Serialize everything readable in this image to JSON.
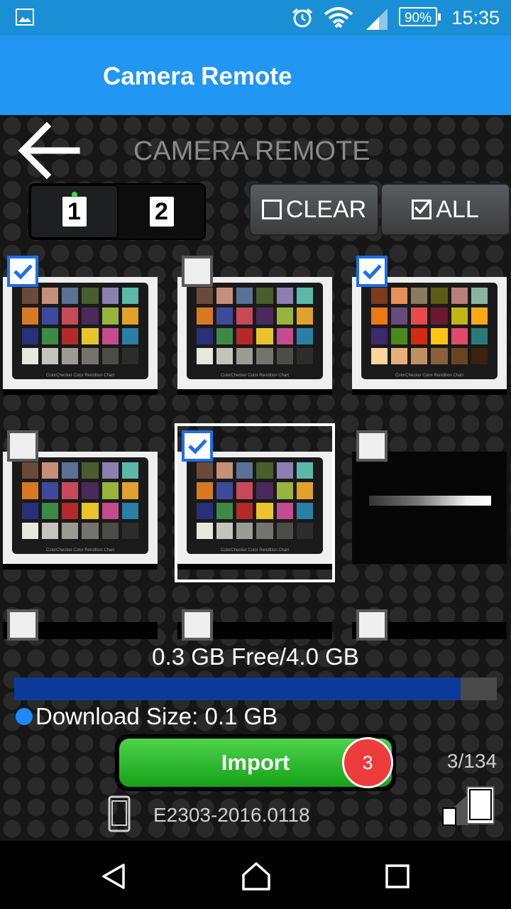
{
  "status_bar": {
    "time": "15:35",
    "battery": "90%"
  },
  "app_bar": {
    "title": "Camera Remote"
  },
  "header": {
    "title": "CAMERA REMOTE"
  },
  "tabs": [
    {
      "label": "1",
      "active": true
    },
    {
      "label": "2",
      "active": false
    }
  ],
  "toolbar": {
    "clear_label": "CLEAR",
    "all_label": "ALL"
  },
  "thumbnails": [
    {
      "checked": true,
      "kind": "color-chart"
    },
    {
      "checked": false,
      "kind": "color-chart"
    },
    {
      "checked": true,
      "kind": "color-chart-warm"
    },
    {
      "checked": false,
      "kind": "color-chart"
    },
    {
      "checked": true,
      "kind": "color-chart",
      "selected": true
    },
    {
      "checked": false,
      "kind": "dark-gradient"
    },
    {
      "checked": false,
      "kind": "partial"
    },
    {
      "checked": false,
      "kind": "partial"
    },
    {
      "checked": false,
      "kind": "partial"
    }
  ],
  "chart_caption": "ColorChecker Color Rendition Chart",
  "storage": {
    "text": "0.3 GB Free/4.0 GB",
    "used_fraction": 0.925
  },
  "download": {
    "label": "Download Size: 0.1 GB"
  },
  "import": {
    "label": "Import",
    "badge": "3"
  },
  "count": "3/134",
  "device": {
    "name": "E2303-2016.0118"
  },
  "colors": {
    "accent": "#2196f3",
    "status_bar": "#1a8fd6",
    "import_green": "#16a216",
    "badge_red": "#ee3b3b",
    "storage_fill": "#0b3a9a"
  }
}
